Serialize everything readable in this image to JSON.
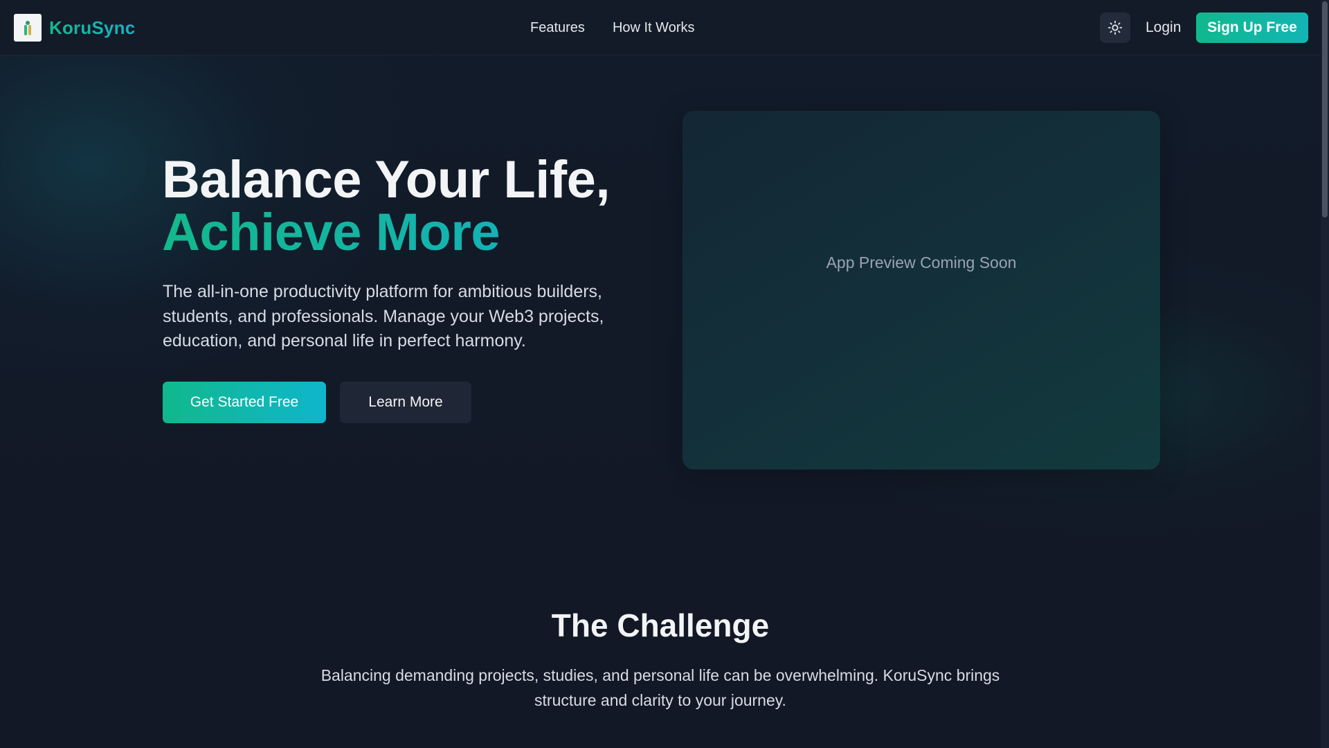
{
  "nav": {
    "brand": "KoruSync",
    "links": [
      "Features",
      "How It Works"
    ],
    "login": "Login",
    "signup": "Sign Up Free",
    "theme_icon": "sun-icon",
    "logo_icon": "koru-logo-icon"
  },
  "hero": {
    "title_line1": "Balance Your Life,",
    "title_line2": "Achieve More",
    "subtitle": "The all-in-one productivity platform for ambitious builders, students, and professionals. Manage your Web3 projects, education, and personal life in perfect harmony.",
    "primary_cta": "Get Started Free",
    "secondary_cta": "Learn More",
    "preview_text": "App Preview Coming Soon"
  },
  "challenge": {
    "title": "The Challenge",
    "text": "Balancing demanding projects, studies, and personal life can be overwhelming. KoruSync brings structure and clarity to your journey."
  },
  "colors": {
    "background": "#121826",
    "accent_start": "#10b88c",
    "accent_end": "#13b5c4",
    "secondary_button": "#1f2635"
  }
}
